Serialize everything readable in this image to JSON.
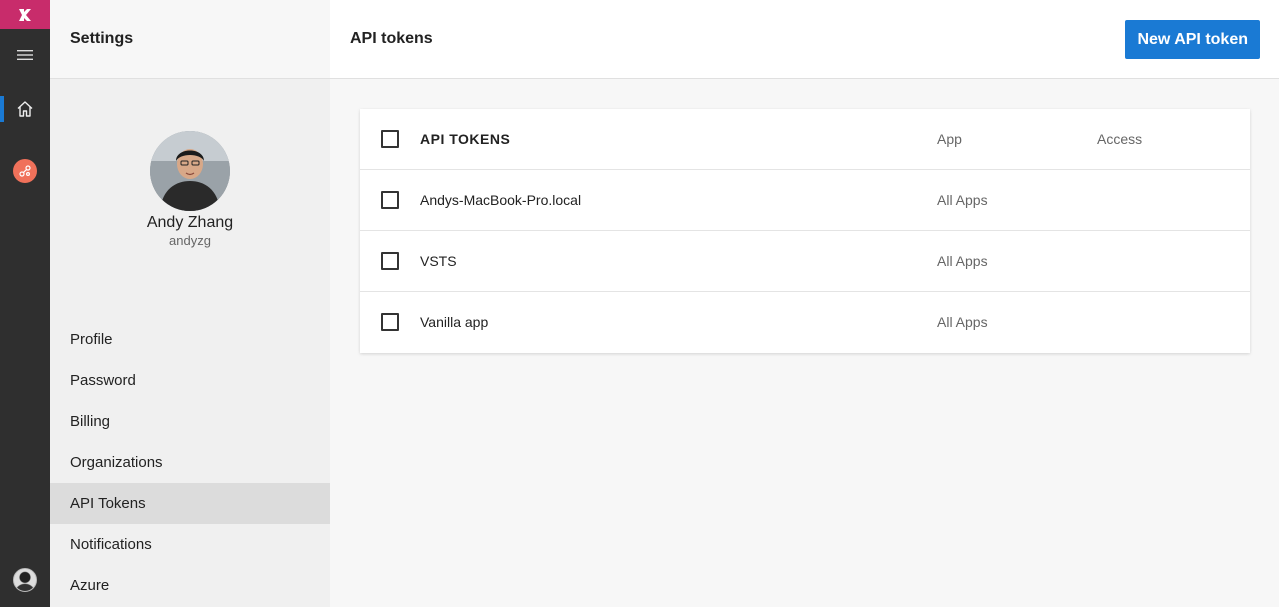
{
  "rail": {
    "logo_icon": "vs-logo-icon",
    "items": [
      {
        "icon": "hamburger-menu-icon"
      },
      {
        "icon": "home-icon",
        "active": true
      },
      {
        "icon": "graph-nodes-icon"
      },
      {
        "icon": "user-avatar-icon"
      }
    ],
    "colors": {
      "logo_bg": "#c82c6b",
      "active_marker": "#1a7ad4",
      "graph_icon": "#f0715a"
    }
  },
  "sidebar": {
    "title": "Settings",
    "profile": {
      "name": "Andy Zhang",
      "handle": "andyzg"
    },
    "nav": [
      {
        "label": "Profile"
      },
      {
        "label": "Password"
      },
      {
        "label": "Billing"
      },
      {
        "label": "Organizations"
      },
      {
        "label": "API Tokens",
        "active": true
      },
      {
        "label": "Notifications"
      },
      {
        "label": "Azure"
      }
    ]
  },
  "main": {
    "title": "API tokens",
    "new_button_label": "New API token",
    "accent_color": "#1a7ad4",
    "table": {
      "headers": {
        "name": "API TOKENS",
        "app": "App",
        "access": "Access"
      },
      "rows": [
        {
          "name": "Andys-MacBook-Pro.local",
          "app": "All Apps",
          "access": ""
        },
        {
          "name": "VSTS",
          "app": "All Apps",
          "access": ""
        },
        {
          "name": "Vanilla app",
          "app": "All Apps",
          "access": ""
        }
      ]
    }
  }
}
